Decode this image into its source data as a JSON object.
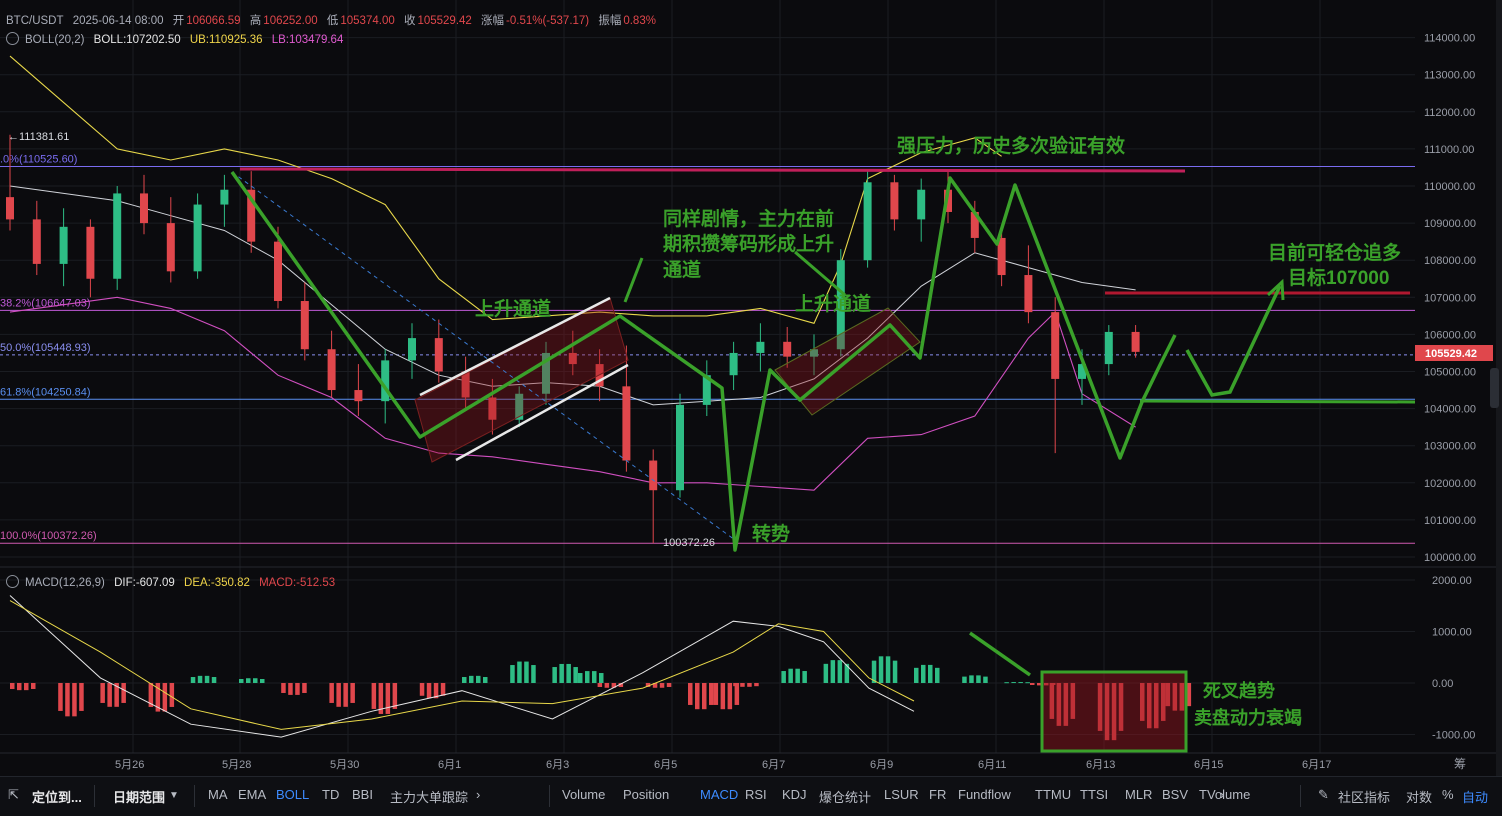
{
  "header": {
    "symbol": "BTC/USDT",
    "datetime": "2025-06-14 08:00",
    "open_label": "开",
    "open": "106066.59",
    "high_label": "高",
    "high": "106252.00",
    "low_label": "低",
    "low": "105374.00",
    "close_label": "收",
    "close": "105529.42",
    "change_label": "涨幅",
    "change": "-0.51%(-537.17)",
    "amplitude_label": "振幅",
    "amplitude": "0.83%"
  },
  "boll_legend": {
    "name": "BOLL(20,2)",
    "boll": "BOLL:107202.50",
    "ub": "UB:110925.36",
    "lb": "LB:103479.64"
  },
  "macd_legend": {
    "name": "MACD(12,26,9)",
    "dif": "DIF:-607.09",
    "dea": "DEA:-350.82",
    "macd": "MACD:-512.53"
  },
  "toolbar": {
    "locate": "定位到...",
    "date_range": "日期范围",
    "main_indicators": [
      "MA",
      "EMA",
      "BOLL",
      "TD",
      "BBI",
      "主力大单跟踪"
    ],
    "active_main": "BOLL",
    "sub_indicators": [
      "Volume",
      "Position",
      "MACD",
      "RSI",
      "KDJ",
      "爆仓统计",
      "LSUR",
      "FR",
      "Fundflow",
      "TTMU",
      "TTSI",
      "MLR",
      "BSV",
      "TVolume"
    ],
    "active_sub": "MACD",
    "community": "社区指标",
    "log": "对数",
    "percent": "%",
    "auto": "自动"
  },
  "axis_corner_label": "筹",
  "colors": {
    "up": "#2ebd85",
    "down": "#e0474c",
    "ub": "#e8d84a",
    "mid": "#cfd2d8",
    "lb": "#d04fc0",
    "annotation": "#3aa12a",
    "resistance": "#c0205a",
    "fib": "#7a5cf0",
    "active": "#3d8bff"
  },
  "chart_data": [
    {
      "type": "candlestick",
      "title": "BTC/USDT",
      "x_ticks": [
        "5月26",
        "5月28",
        "5月30",
        "6月1",
        "6月3",
        "6月5",
        "6月7",
        "6月9",
        "6月11",
        "6月13",
        "6月15",
        "6月17"
      ],
      "y_ticks": [
        "114000.00",
        "113000.00",
        "112000.00",
        "111000.00",
        "110000.00",
        "109000.00",
        "108000.00",
        "107000.00",
        "106000.00",
        "105000.00",
        "104000.00",
        "103000.00",
        "102000.00",
        "101000.00",
        "100000.00"
      ],
      "ylim": [
        99800,
        114500
      ],
      "ohlc_series": [
        {
          "x": 0.0,
          "o": 109700,
          "h": 111381.61,
          "l": 108800,
          "c": 109100
        },
        {
          "x": 0.5,
          "o": 109100,
          "h": 109600,
          "l": 107600,
          "c": 107900
        },
        {
          "x": 1.0,
          "o": 107900,
          "h": 109400,
          "l": 107300,
          "c": 108900
        },
        {
          "x": 1.5,
          "o": 108900,
          "h": 109100,
          "l": 107000,
          "c": 107500
        },
        {
          "x": 2.0,
          "o": 107500,
          "h": 110000,
          "l": 107200,
          "c": 109800
        },
        {
          "x": 2.5,
          "o": 109800,
          "h": 110300,
          "l": 108700,
          "c": 109000
        },
        {
          "x": 3.0,
          "o": 109000,
          "h": 109700,
          "l": 107400,
          "c": 107700
        },
        {
          "x": 3.5,
          "o": 107700,
          "h": 109800,
          "l": 107500,
          "c": 109500
        },
        {
          "x": 4.0,
          "o": 109500,
          "h": 110300,
          "l": 108900,
          "c": 109900
        },
        {
          "x": 4.5,
          "o": 109900,
          "h": 110400,
          "l": 108200,
          "c": 108500
        },
        {
          "x": 5.0,
          "o": 108500,
          "h": 108900,
          "l": 106700,
          "c": 106900
        },
        {
          "x": 5.5,
          "o": 106900,
          "h": 107400,
          "l": 105300,
          "c": 105600
        },
        {
          "x": 6.0,
          "o": 105600,
          "h": 106100,
          "l": 104300,
          "c": 104500
        },
        {
          "x": 6.5,
          "o": 104500,
          "h": 105200,
          "l": 103800,
          "c": 104200
        },
        {
          "x": 7.0,
          "o": 104200,
          "h": 105600,
          "l": 103600,
          "c": 105300
        },
        {
          "x": 7.5,
          "o": 105300,
          "h": 106300,
          "l": 104800,
          "c": 105900
        },
        {
          "x": 8.0,
          "o": 105900,
          "h": 106400,
          "l": 104700,
          "c": 105000
        },
        {
          "x": 8.5,
          "o": 105000,
          "h": 105400,
          "l": 104000,
          "c": 104300
        },
        {
          "x": 9.0,
          "o": 104300,
          "h": 104800,
          "l": 103300,
          "c": 103700
        },
        {
          "x": 9.5,
          "o": 103700,
          "h": 104600,
          "l": 103500,
          "c": 104400
        },
        {
          "x": 10.0,
          "o": 104400,
          "h": 105800,
          "l": 104100,
          "c": 105500
        },
        {
          "x": 10.5,
          "o": 105500,
          "h": 106100,
          "l": 104900,
          "c": 105200
        },
        {
          "x": 11.0,
          "o": 105200,
          "h": 105600,
          "l": 104200,
          "c": 104600
        },
        {
          "x": 11.5,
          "o": 104600,
          "h": 105700,
          "l": 102300,
          "c": 102600
        },
        {
          "x": 12.0,
          "o": 102600,
          "h": 102900,
          "l": 100372.26,
          "c": 101800
        },
        {
          "x": 12.5,
          "o": 101800,
          "h": 104400,
          "l": 101600,
          "c": 104100
        },
        {
          "x": 13.0,
          "o": 104100,
          "h": 105300,
          "l": 103800,
          "c": 104900
        },
        {
          "x": 13.5,
          "o": 104900,
          "h": 105800,
          "l": 104500,
          "c": 105500
        },
        {
          "x": 14.0,
          "o": 105500,
          "h": 106300,
          "l": 105000,
          "c": 105800
        },
        {
          "x": 14.5,
          "o": 105800,
          "h": 106200,
          "l": 105100,
          "c": 105400
        },
        {
          "x": 15.0,
          "o": 105400,
          "h": 106000,
          "l": 104900,
          "c": 105600
        },
        {
          "x": 15.5,
          "o": 105600,
          "h": 108300,
          "l": 105400,
          "c": 108000
        },
        {
          "x": 16.0,
          "o": 108000,
          "h": 110400,
          "l": 107800,
          "c": 110100
        },
        {
          "x": 16.5,
          "o": 110100,
          "h": 110300,
          "l": 108800,
          "c": 109100
        },
        {
          "x": 17.0,
          "o": 109100,
          "h": 110200,
          "l": 108500,
          "c": 109900
        },
        {
          "x": 17.5,
          "o": 109900,
          "h": 110400,
          "l": 109000,
          "c": 109300
        },
        {
          "x": 18.0,
          "o": 109300,
          "h": 109600,
          "l": 108200,
          "c": 108600
        },
        {
          "x": 18.5,
          "o": 108600,
          "h": 108900,
          "l": 107300,
          "c": 107600
        },
        {
          "x": 19.0,
          "o": 107600,
          "h": 108400,
          "l": 106300,
          "c": 106600
        },
        {
          "x": 19.5,
          "o": 106600,
          "h": 107000,
          "l": 102800,
          "c": 104800
        },
        {
          "x": 20.0,
          "o": 104800,
          "h": 105600,
          "l": 104100,
          "c": 105200
        },
        {
          "x": 20.5,
          "o": 105200,
          "h": 106252,
          "l": 104900,
          "c": 106066.59
        },
        {
          "x": 21.0,
          "o": 106066.59,
          "h": 106252,
          "l": 105374,
          "c": 105529.42
        }
      ],
      "bollinger": {
        "ub": [
          [
            0,
            113500
          ],
          [
            2,
            111000
          ],
          [
            3,
            110700
          ],
          [
            4,
            111000
          ],
          [
            5,
            110700
          ],
          [
            6,
            110200
          ],
          [
            7,
            109500
          ],
          [
            8,
            107500
          ],
          [
            9,
            106400
          ],
          [
            10,
            106500
          ],
          [
            11,
            106600
          ],
          [
            12,
            106500
          ],
          [
            13,
            106500
          ],
          [
            14,
            106700
          ],
          [
            15,
            106300
          ],
          [
            15.5,
            107900
          ],
          [
            16,
            110200
          ],
          [
            17,
            110900
          ],
          [
            18,
            111300
          ],
          [
            18.5,
            110800
          ]
        ],
        "mid": [
          [
            0,
            110000
          ],
          [
            2,
            109600
          ],
          [
            3,
            109200
          ],
          [
            4,
            108800
          ],
          [
            5,
            108000
          ],
          [
            6,
            106800
          ],
          [
            7,
            105600
          ],
          [
            8,
            104900
          ],
          [
            9,
            104600
          ],
          [
            10,
            104700
          ],
          [
            11,
            104600
          ],
          [
            12,
            104100
          ],
          [
            13,
            104200
          ],
          [
            14,
            104300
          ],
          [
            15,
            104800
          ],
          [
            16,
            105900
          ],
          [
            17,
            107300
          ],
          [
            18,
            108200
          ],
          [
            19,
            107800
          ],
          [
            20,
            107400
          ],
          [
            21,
            107200
          ]
        ],
        "lb": [
          [
            0,
            106600
          ],
          [
            2,
            107000
          ],
          [
            3,
            106700
          ],
          [
            4,
            106100
          ],
          [
            5,
            104900
          ],
          [
            6,
            104300
          ],
          [
            7,
            103200
          ],
          [
            8,
            102800
          ],
          [
            9,
            102700
          ],
          [
            10,
            102500
          ],
          [
            11,
            102300
          ],
          [
            12,
            102000
          ],
          [
            13,
            102000
          ],
          [
            14,
            101900
          ],
          [
            15,
            101800
          ],
          [
            16,
            103200
          ],
          [
            17,
            103300
          ],
          [
            18,
            103800
          ],
          [
            19,
            105900
          ],
          [
            19.5,
            106600
          ],
          [
            20,
            104400
          ],
          [
            21,
            103500
          ]
        ]
      },
      "price_lines": [
        {
          "label": ".0%(110525.60)",
          "value": 110525.6
        },
        {
          "label": "38.2%(106647.03)",
          "value": 106647.03
        },
        {
          "label": "50.0%(105448.93)",
          "value": 105448.93
        },
        {
          "label": "61.8%(104250.84)",
          "value": 104250.84
        },
        {
          "label": "100.0%(100372.26)",
          "value": 100372.26
        }
      ],
      "high_marker": "←111381.61",
      "low_marker": "100372.26",
      "last_price": "105529.42",
      "annotations": [
        "上升通道",
        "同样剧情，主力在前",
        "期积攒筹码形成上升",
        "通道",
        "上升通道",
        "转势",
        "强压力，历史多次验证有效",
        "目前可轻仓追多",
        "目标107000"
      ]
    },
    {
      "type": "bar",
      "title": "MACD(12,26,9)",
      "y_ticks": [
        "2000.00",
        "1000.00",
        "0.00",
        "-1000.00"
      ],
      "ylim": [
        -1400,
        2100
      ],
      "macd_hist": [
        [
          0,
          -150
        ],
        [
          1,
          -700
        ],
        [
          2,
          -500
        ],
        [
          3,
          -600
        ],
        [
          4,
          150
        ],
        [
          5,
          100
        ],
        [
          6,
          -250
        ],
        [
          7,
          -500
        ],
        [
          8,
          -650
        ],
        [
          9,
          -320
        ],
        [
          10,
          150
        ],
        [
          11,
          450
        ],
        [
          12,
          400
        ],
        [
          12.5,
          250
        ],
        [
          13,
          -100
        ],
        [
          14,
          -100
        ],
        [
          15,
          -550
        ],
        [
          15.5,
          -550
        ],
        [
          16,
          -80
        ],
        [
          17,
          300
        ],
        [
          18,
          480
        ],
        [
          19,
          560
        ],
        [
          20,
          380
        ],
        [
          21,
          160
        ],
        [
          22,
          20
        ],
        [
          22.5,
          -50
        ],
        [
          23,
          -900
        ],
        [
          24,
          -1200
        ],
        [
          25,
          -950
        ],
        [
          25.5,
          -580
        ]
      ],
      "dif": [
        [
          0,
          1700
        ],
        [
          2,
          100
        ],
        [
          4,
          -800
        ],
        [
          6,
          -1050
        ],
        [
          8,
          -550
        ],
        [
          10,
          -150
        ],
        [
          12,
          -700
        ],
        [
          14,
          200
        ],
        [
          16,
          1200
        ],
        [
          17,
          1100
        ],
        [
          18,
          800
        ],
        [
          19,
          -100
        ],
        [
          20,
          -550
        ]
      ],
      "dea": [
        [
          0,
          1600
        ],
        [
          2,
          600
        ],
        [
          4,
          -500
        ],
        [
          6,
          -900
        ],
        [
          8,
          -700
        ],
        [
          10,
          -350
        ],
        [
          12,
          -400
        ],
        [
          14,
          -100
        ],
        [
          16,
          600
        ],
        [
          17,
          1150
        ],
        [
          18,
          1000
        ],
        [
          19,
          100
        ],
        [
          20,
          -350
        ]
      ],
      "annotations": [
        "死叉趋势",
        "卖盘动力衰竭"
      ]
    }
  ]
}
